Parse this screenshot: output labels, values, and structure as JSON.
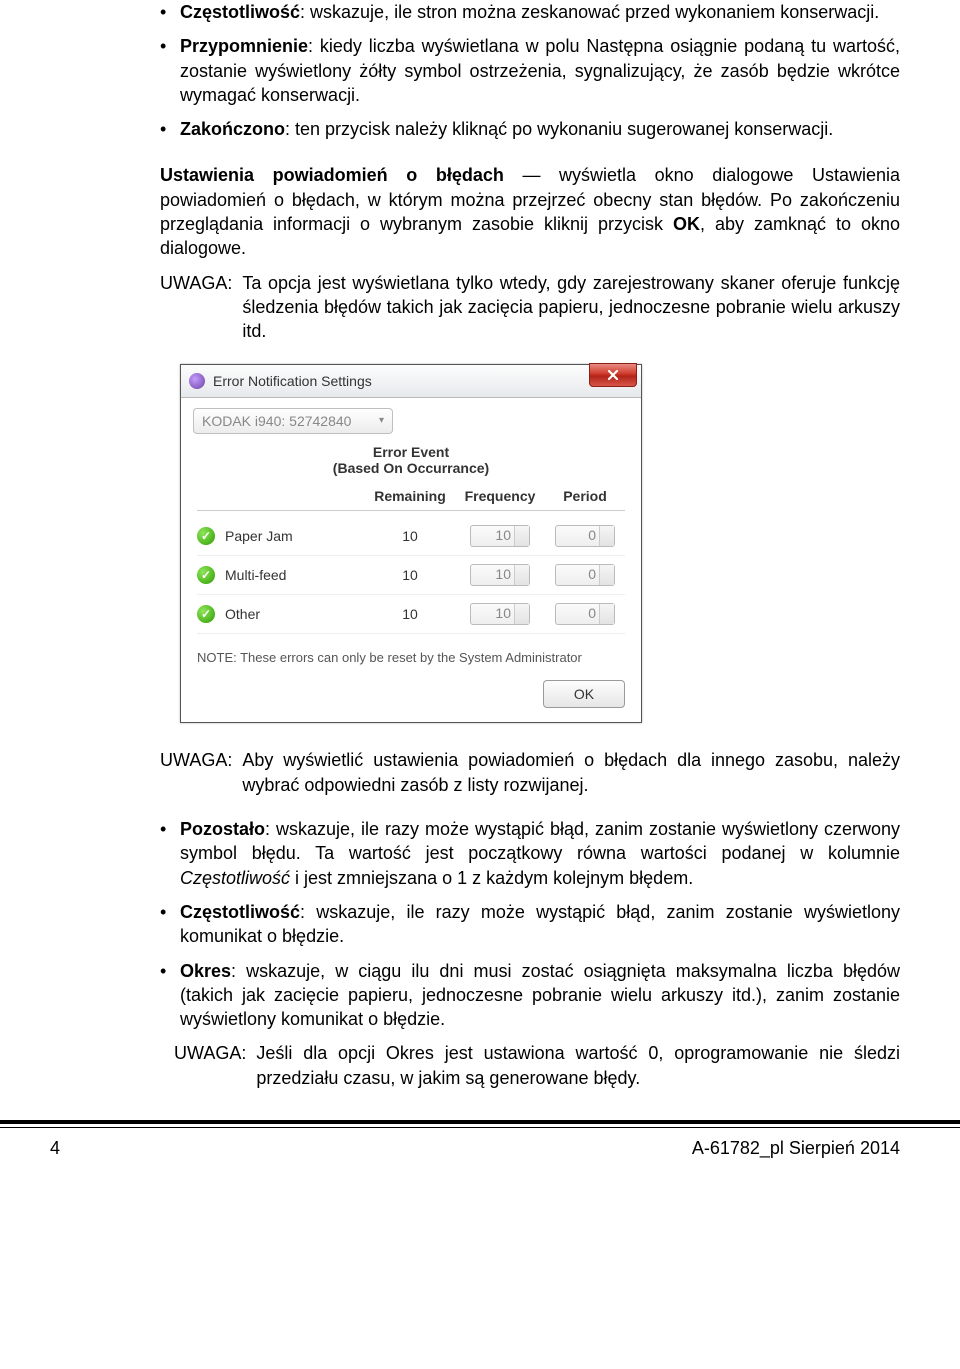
{
  "bullets1": [
    {
      "term": "Częstotliwość",
      "text": ": wskazuje, ile stron można zeskanować przed wykonaniem konserwacji."
    },
    {
      "term": "Przypomnienie",
      "text": ": kiedy liczba wyświetlana w polu Następna osiągnie podaną tu wartość, zostanie wyświetlony żółty symbol ostrzeżenia, sygnalizujący, że zasób będzie wkrótce wymagać konserwacji."
    },
    {
      "term": "Zakończono",
      "text": ": ten przycisk należy kliknąć po wykonaniu sugerowanej konserwacji."
    }
  ],
  "para1_bold": "Ustawienia powiadomień o błędach",
  "para1_rest": " — wyświetla okno dialogowe Ustawienia powiadomień o błędach, w którym można przejrzeć obecny stan błędów. Po zakończeniu przeglądania informacji o wybranym zasobie kliknij przycisk ",
  "para1_bold2": "OK",
  "para1_tail": ", aby zamknąć to okno dialogowe.",
  "note1_label": "UWAGA:",
  "note1_body": "Ta opcja jest wyświetlana tylko wtedy, gdy zarejestrowany skaner oferuje funkcję śledzenia błędów takich jak zacięcia papieru, jednoczesne pobranie wielu arkuszy itd.",
  "dialog": {
    "title": "Error Notification Settings",
    "dropdown": "KODAK i940: 52742840",
    "section_title": "Error Event",
    "section_sub": "(Based On Occurrance)",
    "headers": {
      "remaining": "Remaining",
      "frequency": "Frequency",
      "period": "Period"
    },
    "rows": [
      {
        "name": "Paper Jam",
        "remaining": "10",
        "frequency": "10",
        "period": "0"
      },
      {
        "name": "Multi-feed",
        "remaining": "10",
        "frequency": "10",
        "period": "0"
      },
      {
        "name": "Other",
        "remaining": "10",
        "frequency": "10",
        "period": "0"
      }
    ],
    "note": "NOTE: These errors can only be reset by the System Administrator",
    "ok": "OK"
  },
  "note2_label": "UWAGA:",
  "note2_body": "Aby wyświetlić ustawienia powiadomień o błędach dla innego zasobu, należy wybrać odpowiedni zasób z listy rozwijanej.",
  "bullets2": [
    {
      "term": "Pozostało",
      "rest": ": wskazuje, ile razy może wystąpić błąd, zanim zostanie wyświetlony czerwony symbol błędu. Ta wartość jest początkowy równa wartości podanej w kolumnie ",
      "em": "Częstotliwość",
      "tail": " i jest zmniejszana o 1 z każdym kolejnym błędem."
    },
    {
      "term": "Częstotliwość",
      "rest": ": wskazuje, ile razy może wystąpić błąd, zanim zostanie wyświetlony komunikat o błędzie.",
      "em": "",
      "tail": ""
    },
    {
      "term": "Okres",
      "rest": ": wskazuje, w ciągu ilu dni musi zostać osiągnięta maksymalna liczba błędów (takich jak zacięcie papieru, jednoczesne pobranie wielu arkuszy itd.), zanim zostanie wyświetlony komunikat o błędzie.",
      "em": "",
      "tail": ""
    }
  ],
  "note3_label": "UWAGA:",
  "note3_body": "Jeśli dla opcji Okres jest ustawiona wartość 0, oprogramowanie nie śledzi przedziału czasu, w jakim są generowane błędy.",
  "footer_left": "4",
  "footer_right": "A-61782_pl  Sierpień 2014"
}
